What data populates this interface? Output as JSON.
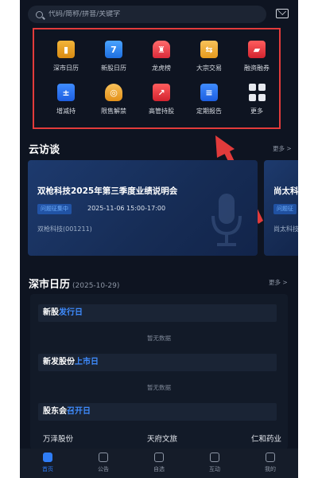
{
  "search": {
    "placeholder": "代码/简称/拼音/关键字"
  },
  "grid": {
    "items": [
      {
        "label": "深市日历",
        "icon": "calendar-chart-icon"
      },
      {
        "label": "新股日历",
        "icon": "calendar-icon",
        "badge": "7"
      },
      {
        "label": "龙虎榜",
        "icon": "dragon-tiger-icon"
      },
      {
        "label": "大宗交易",
        "icon": "exchange-icon"
      },
      {
        "label": "融资融券",
        "icon": "wallet-icon"
      },
      {
        "label": "增减持",
        "icon": "plus-minus-icon"
      },
      {
        "label": "限售解禁",
        "icon": "shield-unlock-icon"
      },
      {
        "label": "高管持股",
        "icon": "executive-icon"
      },
      {
        "label": "定期报告",
        "icon": "report-icon"
      },
      {
        "label": "更多",
        "icon": "grid-more-icon"
      }
    ]
  },
  "cloud": {
    "title": "云访谈",
    "more": "更多 >",
    "cards": [
      {
        "title": "双枪科技2025年第三季度业绩说明会",
        "tag": "问题征集中",
        "time": "2025-11-06 15:00-17:00",
        "stock": "双枪科技(001211)"
      },
      {
        "title": "尚太科",
        "tag": "问题征",
        "stock": "尚太科技"
      }
    ]
  },
  "calendar": {
    "title": "深市日历",
    "date": "(2025-10-29)",
    "more": "更多 >",
    "rows": [
      {
        "prefix": "新股",
        "highlight": "发行日",
        "empty": "暂无数据"
      },
      {
        "prefix": "新发股份",
        "highlight": "上市日",
        "empty": "暂无数据"
      },
      {
        "prefix": "股东会",
        "highlight": "召开日"
      }
    ],
    "agm": [
      "万泽股份",
      "天府文旅",
      "仁和药业"
    ]
  },
  "nav": {
    "items": [
      {
        "label": "首页",
        "active": true
      },
      {
        "label": "公告"
      },
      {
        "label": "自选"
      },
      {
        "label": "互动"
      },
      {
        "label": "我的"
      }
    ]
  },
  "colors": {
    "accent": "#2f7df6",
    "highlight_border": "#e23b3b",
    "background": "#0e1421"
  }
}
